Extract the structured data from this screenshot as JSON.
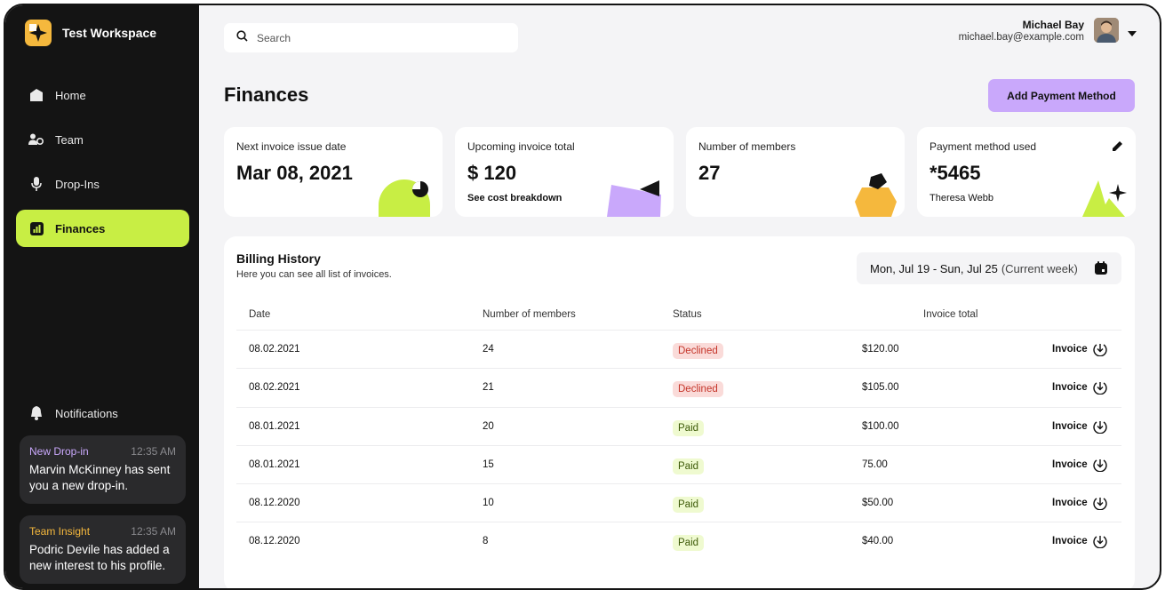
{
  "workspace": {
    "name": "Test Workspace"
  },
  "nav": [
    {
      "label": "Home",
      "icon": "home-icon"
    },
    {
      "label": "Team",
      "icon": "team-icon"
    },
    {
      "label": "Drop-Ins",
      "icon": "microphone-icon"
    },
    {
      "label": "Finances",
      "icon": "chart-icon",
      "active": true
    }
  ],
  "notifications": {
    "label": "Notifications",
    "items": [
      {
        "type": "New Drop-in",
        "type_color": "#c9a8fb",
        "time": "12:35 AM",
        "message": "Marvin McKinney has sent you a new drop-in."
      },
      {
        "type": "Team Insight",
        "type_color": "#f5b83d",
        "time": "12:35 AM",
        "message": "Podric Devile has added a new interest to his profile."
      }
    ]
  },
  "search": {
    "placeholder": "Search"
  },
  "user": {
    "name": "Michael Bay",
    "email": "michael.bay@example.com"
  },
  "page": {
    "title": "Finances",
    "add_button": "Add Payment Method"
  },
  "stats": [
    {
      "label": "Next invoice issue date",
      "value": "Mar 08, 2021",
      "sub": ""
    },
    {
      "label": "Upcoming invoice total",
      "value": "$ 120",
      "sub": "See cost breakdown"
    },
    {
      "label": "Number of members",
      "value": "27",
      "sub": ""
    },
    {
      "label": "Payment method used",
      "value": "*5465",
      "sub": "Theresa Webb"
    }
  ],
  "billing": {
    "title": "Billing History",
    "subtitle": "Here you can see all list of invoices.",
    "week_range": "Mon, Jul 19 - Sun, Jul 25",
    "week_note": "(Current week)",
    "columns": [
      "Date",
      "Number of members",
      "Status",
      "Invoice total"
    ],
    "invoice_label": "Invoice",
    "rows": [
      {
        "date": "08.02.2021",
        "members": "24",
        "status": "Declined",
        "total": "$120.00"
      },
      {
        "date": "08.02.2021",
        "members": "21",
        "status": "Declined",
        "total": "$105.00"
      },
      {
        "date": "08.01.2021",
        "members": "20",
        "status": "Paid",
        "total": "$100.00"
      },
      {
        "date": "08.01.2021",
        "members": "15",
        "status": "Paid",
        "total": "75.00"
      },
      {
        "date": "08.12.2020",
        "members": "10",
        "status": "Paid",
        "total": "$50.00"
      },
      {
        "date": "08.12.2020",
        "members": "8",
        "status": "Paid",
        "total": "$40.00"
      }
    ]
  },
  "colors": {
    "accent_green": "#c8ee44",
    "accent_purple": "#c9a8fb",
    "accent_yellow": "#f5b83d",
    "sidebar_bg": "#141414"
  }
}
